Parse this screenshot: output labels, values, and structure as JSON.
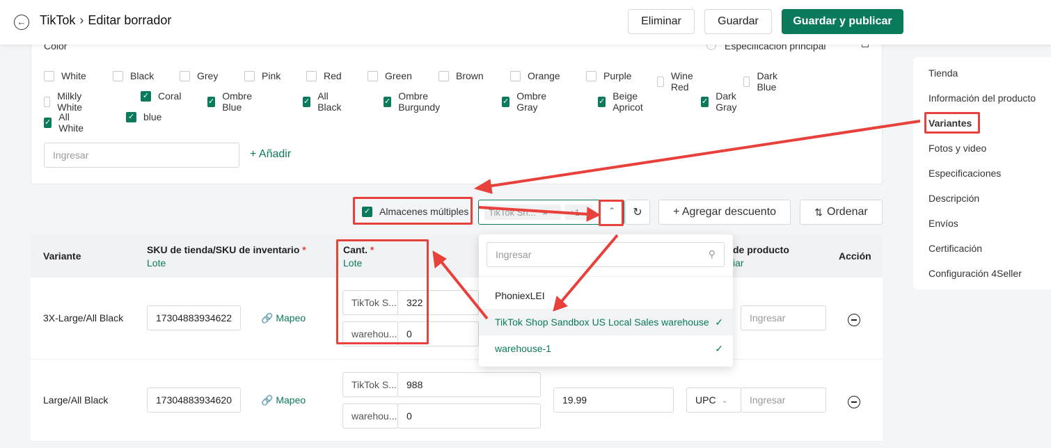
{
  "header": {
    "back_icon": "arrow-left-icon",
    "app": "TikTok",
    "page": "Editar borrador",
    "buttons": {
      "delete": "Eliminar",
      "save": "Guardar",
      "save_publish": "Guardar y publicar"
    }
  },
  "color_section": {
    "title": "Color",
    "main_spec_label": "Especificación principal",
    "options": [
      {
        "label": "White",
        "checked": false
      },
      {
        "label": "Black",
        "checked": false
      },
      {
        "label": "Grey",
        "checked": false
      },
      {
        "label": "Pink",
        "checked": false
      },
      {
        "label": "Red",
        "checked": false
      },
      {
        "label": "Green",
        "checked": false
      },
      {
        "label": "Brown",
        "checked": false
      },
      {
        "label": "Orange",
        "checked": false
      },
      {
        "label": "Purple",
        "checked": false
      },
      {
        "label": "Wine Red",
        "checked": false
      },
      {
        "label": "Dark Blue",
        "checked": false
      },
      {
        "label": "Milkly White",
        "checked": false
      },
      {
        "label": "Coral",
        "checked": true
      },
      {
        "label": "Ombre Blue",
        "checked": true
      },
      {
        "label": "All Black",
        "checked": true
      },
      {
        "label": "Ombre Burgundy",
        "checked": true
      },
      {
        "label": "Ombre Gray",
        "checked": true
      },
      {
        "label": "Beige Apricot",
        "checked": true
      },
      {
        "label": "Dark Gray",
        "checked": true
      },
      {
        "label": "All White",
        "checked": true
      },
      {
        "label": "blue",
        "checked": true
      }
    ],
    "input_placeholder": "Ingresar",
    "add_label": "+ Añadir"
  },
  "toolbar": {
    "multi_warehouse": "Almacenes múltiples",
    "multi_warehouse_checked": true,
    "selected_tag": "TikTok Sh...",
    "add_discount": "+ Agregar descuento",
    "sort": "Ordenar"
  },
  "dropdown": {
    "search_placeholder": "Ingresar",
    "options": [
      {
        "label": "PhoniexLEI",
        "selected": false
      },
      {
        "label": "TikTok Shop Sandbox US Local Sales warehouse",
        "selected": true
      },
      {
        "label": "warehouse-1",
        "selected": true
      }
    ]
  },
  "table": {
    "headers": {
      "variant": "Variante",
      "sku": "SKU de tienda/SKU de inventario",
      "sku_sub": "Lote",
      "qty": "Cant.",
      "qty_sub": "Lote",
      "product_id": "de producto",
      "product_id_sub": "iar",
      "action": "Acción"
    },
    "rows": [
      {
        "variant": "3X-Large/All Black",
        "sku": "17304883934622",
        "mapping": "Mapeo",
        "warehouses": [
          {
            "name": "TikTok S...",
            "qty": "322"
          },
          {
            "name": "warehou...",
            "qty": "0"
          }
        ],
        "price": "",
        "id_type": "",
        "id_placeholder": "Ingresar"
      },
      {
        "variant": "Large/All Black",
        "sku": "17304883934620",
        "mapping": "Mapeo",
        "warehouses": [
          {
            "name": "TikTok S...",
            "qty": "988"
          },
          {
            "name": "warehou...",
            "qty": "0"
          }
        ],
        "price": "19.99",
        "id_type": "UPC",
        "id_placeholder": "Ingresar"
      }
    ]
  },
  "sidebar": {
    "items": [
      "Tienda",
      "Información del producto",
      "Variantes",
      "Fotos y video",
      "Especificaciones",
      "Descripción",
      "Envíos",
      "Certificación",
      "Configuración 4Seller"
    ],
    "active": "Variantes"
  },
  "colors": {
    "accent": "#0b7a5c",
    "annotation": "#e8403a"
  }
}
